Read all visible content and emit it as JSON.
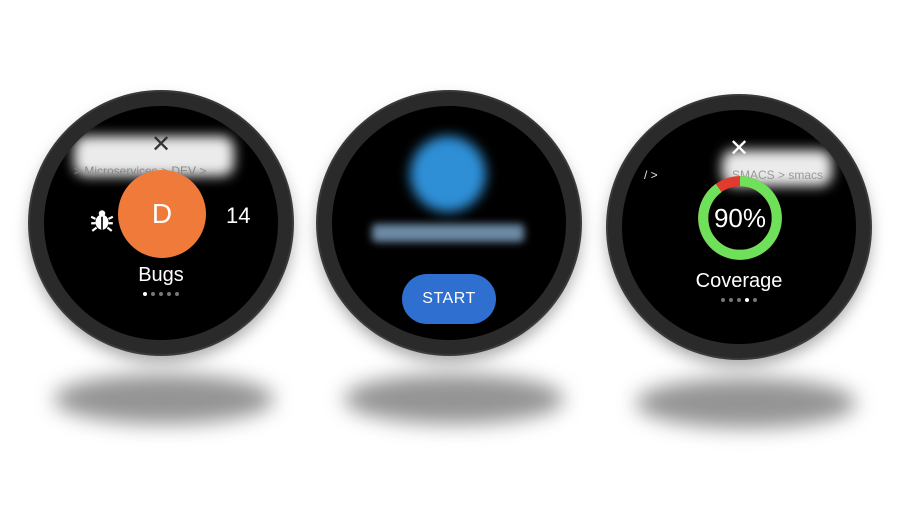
{
  "watch_bugs": {
    "close_glyph": "✕",
    "breadcrumb": "> Microservices > DEV >",
    "icon": "bug-icon",
    "avatar_letter": "D",
    "avatar_color": "#f07a3a",
    "count": "14",
    "label": "Bugs",
    "page_index": 0,
    "page_count": 5
  },
  "watch_start": {
    "button_label": "START",
    "button_color": "#2e6fd0",
    "page_index": 1
  },
  "watch_coverage": {
    "close_glyph": "✕",
    "breadcrumb_left": "/ >",
    "breadcrumb_right": "SMACS > smacs",
    "percent_text": "90%",
    "coverage_fraction": 0.9,
    "covered_color": "#6ee05a",
    "uncovered_color": "#e23a2e",
    "label": "Coverage",
    "page_index": 3,
    "page_count": 5
  }
}
